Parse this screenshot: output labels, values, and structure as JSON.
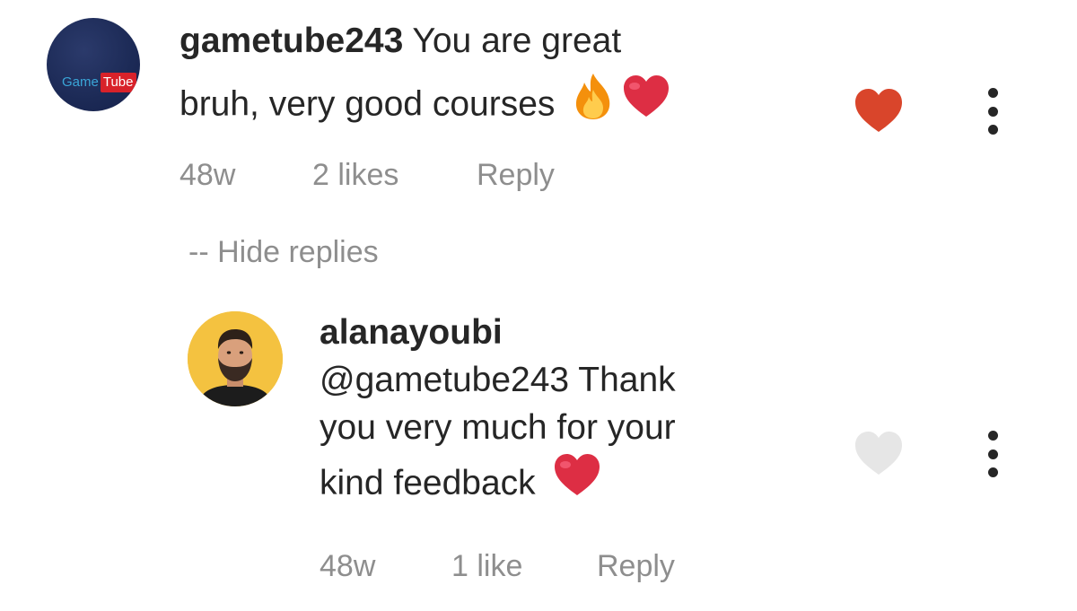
{
  "comments": [
    {
      "avatar": {
        "logo_part1": "Game",
        "logo_part2": "Tube",
        "bg_color": "#1c2a56"
      },
      "username": "gametube243",
      "text_line1": "You are great",
      "text_line2": "bruh, very good courses",
      "emojis": [
        "fire-emoji",
        "red-heart-emoji"
      ],
      "time": "48w",
      "likes": "2 likes",
      "reply_label": "Reply",
      "liked": true,
      "like_color": "#d9452b",
      "more_icon": "more-vertical-icon"
    },
    {
      "username": "alanayoubi",
      "text_line1": "@gametube243 Thank",
      "text_line2": "you very much for your",
      "text_line3": "kind feedback",
      "emojis": [
        "red-heart-emoji"
      ],
      "avatar_bg": "#f4c240",
      "time": "48w",
      "likes": "1 like",
      "reply_label": "Reply",
      "liked": false,
      "like_color": "#e6e6e6",
      "more_icon": "more-vertical-icon"
    }
  ],
  "hide_replies_label": "-- Hide replies"
}
